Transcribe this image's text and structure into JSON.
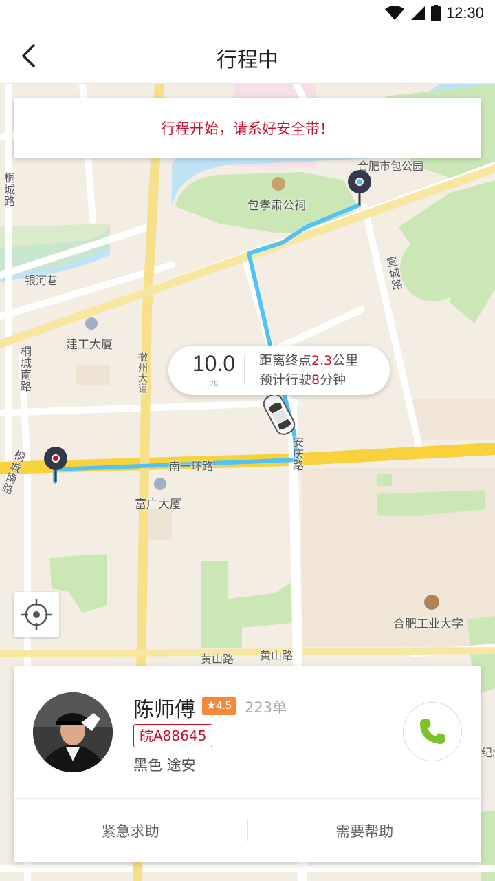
{
  "status_bar": {
    "time": "12:30"
  },
  "header": {
    "title": "行程中"
  },
  "notice": {
    "text": "行程开始，请系好安全带！"
  },
  "trip": {
    "fare": "10.0",
    "fare_unit": "元",
    "distance_prefix": "距离终点",
    "distance_value": "2.3",
    "distance_unit": "公里",
    "eta_prefix": "预计行驶",
    "eta_value": "8",
    "eta_unit": "分钟"
  },
  "map_labels": {
    "bao_park": "合肥市包公园",
    "baoxiaosu": "包孝肃公祠",
    "yinhe": "银河巷",
    "xuancheng": "宣城路",
    "jiangong": "建工大厦",
    "tongcheng_south": "桐城南路",
    "huizhou": "徽州大道",
    "nanyihuan": "南一环路",
    "anqing": "安庆路",
    "fuguang": "富广大厦",
    "tongcheng_south2": "桐城南路",
    "hfut": "合肥工业大学",
    "huangshan1": "黄山路",
    "huangshan2": "黄山路",
    "tongcheng": "桐城路",
    "jinian": "纪念"
  },
  "driver": {
    "name": "陈师傅",
    "rating": "★4.5",
    "orders": "223单",
    "plate": "皖A88645",
    "car": "黑色  途安"
  },
  "actions": {
    "emergency": "紧急求助",
    "help": "需要帮助"
  },
  "colors": {
    "accent_red": "#c8102e",
    "route_blue": "#4fc3f7",
    "rating_orange": "#f5893b",
    "call_green": "#7cc22b"
  },
  "icons": {
    "back": "back-arrow-icon",
    "locate": "crosshair-icon",
    "call": "phone-icon",
    "start": "start-pin-icon",
    "end": "end-pin-icon",
    "car": "car-icon"
  }
}
